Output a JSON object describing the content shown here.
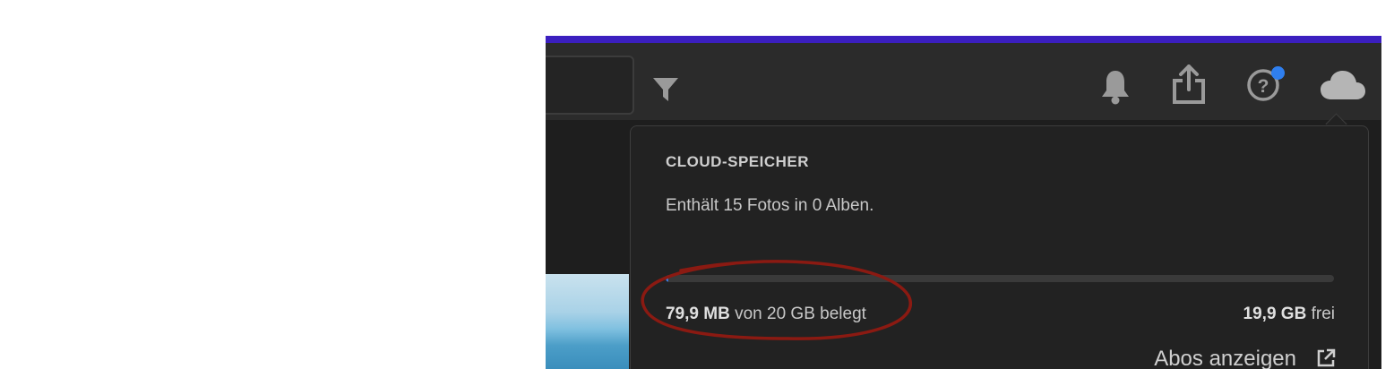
{
  "toolbar": {
    "icons": [
      "filter-icon",
      "bell-icon",
      "share-icon",
      "help-icon",
      "cloud-icon"
    ],
    "help_has_notification": true,
    "accent_color": "#3b1fbf"
  },
  "cloud_storage": {
    "title": "CLOUD-SPEICHER",
    "description": "Enthält 15 Fotos in 0 Alben.",
    "used_amount": "79,9 MB",
    "used_suffix": "von 20 GB belegt",
    "free_amount": "19,9 GB",
    "free_suffix": "frei",
    "usage_fraction": 0.004,
    "bar_fill_color": "#3d78d8",
    "abos_link": "Abos anzeigen",
    "abos_link_icon": "external-link-icon"
  },
  "annotation_color": "#8b1a12"
}
